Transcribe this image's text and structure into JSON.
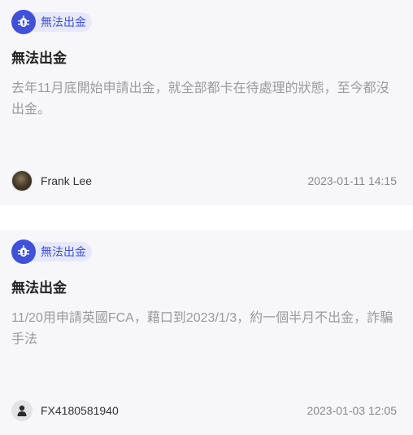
{
  "posts": [
    {
      "tag": "無法出金",
      "title": "無法出金",
      "body": "去年11月底開始申請出金，就全部都卡在待處理的狀態，至今都沒出金。",
      "author": "Frank Lee",
      "date": "2023-01-11 14:15",
      "avatar_icon": "user-photo-icon"
    },
    {
      "tag": "無法出金",
      "title": "無法出金",
      "body": "11/20用申請英國FCA，藉口到2023/1/3，約一個半月不出金，詐騙手法",
      "author": "FX4180581940",
      "date": "2023-01-03 12:05",
      "avatar_icon": "default-user-icon"
    }
  ],
  "colors": {
    "accent": "#3f51d9",
    "tag_bg": "#e7e9fb",
    "card_bg": "#f7f7f9",
    "body_text": "#9a9a9f"
  }
}
